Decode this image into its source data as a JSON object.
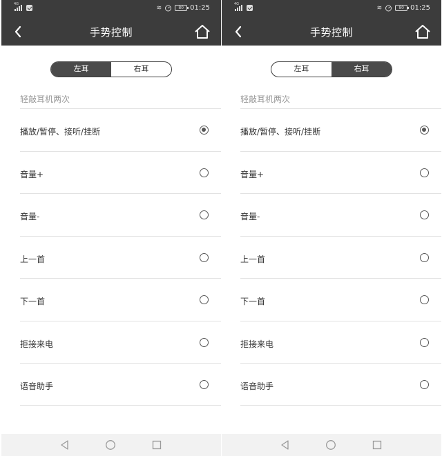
{
  "screens": [
    {
      "status": {
        "network": "4G",
        "battery": "80",
        "time": "01:25"
      },
      "header": {
        "title": "手势控制",
        "back_icon": "chevron-left-icon",
        "home_icon": "home-icon"
      },
      "tabs": [
        {
          "label": "左耳",
          "active": true
        },
        {
          "label": "右耳",
          "active": false
        }
      ],
      "section_label": "轻敲耳机两次",
      "options": [
        {
          "label": "播放/暂停、接听/挂断",
          "selected": true
        },
        {
          "label": "音量+",
          "selected": false
        },
        {
          "label": "音量-",
          "selected": false
        },
        {
          "label": "上一首",
          "selected": false
        },
        {
          "label": "下一首",
          "selected": false
        },
        {
          "label": "拒接来电",
          "selected": false
        },
        {
          "label": "语音助手",
          "selected": false
        }
      ]
    },
    {
      "status": {
        "network": "4G",
        "battery": "80",
        "time": "01:25"
      },
      "header": {
        "title": "手势控制",
        "back_icon": "chevron-left-icon",
        "home_icon": "home-icon"
      },
      "tabs": [
        {
          "label": "左耳",
          "active": false
        },
        {
          "label": "右耳",
          "active": true
        }
      ],
      "section_label": "轻敲耳机两次",
      "options": [
        {
          "label": "播放/暂停、接听/挂断",
          "selected": true
        },
        {
          "label": "音量+",
          "selected": false
        },
        {
          "label": "音量-",
          "selected": false
        },
        {
          "label": "上一首",
          "selected": false
        },
        {
          "label": "下一首",
          "selected": false
        },
        {
          "label": "拒接来电",
          "selected": false
        },
        {
          "label": "语音助手",
          "selected": false
        }
      ]
    }
  ],
  "colors": {
    "header_bg": "#3c3c3c",
    "active_tab": "#4a4a4a",
    "navbar_bg": "#f2f2f2"
  }
}
